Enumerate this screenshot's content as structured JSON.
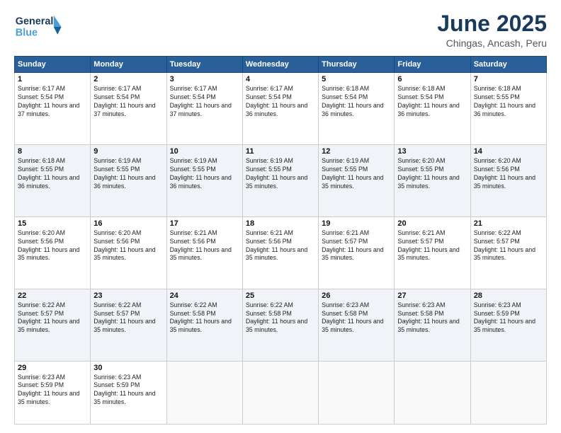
{
  "logo": {
    "line1": "General",
    "line2": "Blue"
  },
  "title": "June 2025",
  "subtitle": "Chingas, Ancash, Peru",
  "days_header": [
    "Sunday",
    "Monday",
    "Tuesday",
    "Wednesday",
    "Thursday",
    "Friday",
    "Saturday"
  ],
  "weeks": [
    [
      {
        "day": "1",
        "sunrise": "6:17 AM",
        "sunset": "5:54 PM",
        "daylight": "11 hours and 37 minutes."
      },
      {
        "day": "2",
        "sunrise": "6:17 AM",
        "sunset": "5:54 PM",
        "daylight": "11 hours and 37 minutes."
      },
      {
        "day": "3",
        "sunrise": "6:17 AM",
        "sunset": "5:54 PM",
        "daylight": "11 hours and 37 minutes."
      },
      {
        "day": "4",
        "sunrise": "6:17 AM",
        "sunset": "5:54 PM",
        "daylight": "11 hours and 36 minutes."
      },
      {
        "day": "5",
        "sunrise": "6:18 AM",
        "sunset": "5:54 PM",
        "daylight": "11 hours and 36 minutes."
      },
      {
        "day": "6",
        "sunrise": "6:18 AM",
        "sunset": "5:54 PM",
        "daylight": "11 hours and 36 minutes."
      },
      {
        "day": "7",
        "sunrise": "6:18 AM",
        "sunset": "5:55 PM",
        "daylight": "11 hours and 36 minutes."
      }
    ],
    [
      {
        "day": "8",
        "sunrise": "6:18 AM",
        "sunset": "5:55 PM",
        "daylight": "11 hours and 36 minutes."
      },
      {
        "day": "9",
        "sunrise": "6:19 AM",
        "sunset": "5:55 PM",
        "daylight": "11 hours and 36 minutes."
      },
      {
        "day": "10",
        "sunrise": "6:19 AM",
        "sunset": "5:55 PM",
        "daylight": "11 hours and 36 minutes."
      },
      {
        "day": "11",
        "sunrise": "6:19 AM",
        "sunset": "5:55 PM",
        "daylight": "11 hours and 35 minutes."
      },
      {
        "day": "12",
        "sunrise": "6:19 AM",
        "sunset": "5:55 PM",
        "daylight": "11 hours and 35 minutes."
      },
      {
        "day": "13",
        "sunrise": "6:20 AM",
        "sunset": "5:55 PM",
        "daylight": "11 hours and 35 minutes."
      },
      {
        "day": "14",
        "sunrise": "6:20 AM",
        "sunset": "5:56 PM",
        "daylight": "11 hours and 35 minutes."
      }
    ],
    [
      {
        "day": "15",
        "sunrise": "6:20 AM",
        "sunset": "5:56 PM",
        "daylight": "11 hours and 35 minutes."
      },
      {
        "day": "16",
        "sunrise": "6:20 AM",
        "sunset": "5:56 PM",
        "daylight": "11 hours and 35 minutes."
      },
      {
        "day": "17",
        "sunrise": "6:21 AM",
        "sunset": "5:56 PM",
        "daylight": "11 hours and 35 minutes."
      },
      {
        "day": "18",
        "sunrise": "6:21 AM",
        "sunset": "5:56 PM",
        "daylight": "11 hours and 35 minutes."
      },
      {
        "day": "19",
        "sunrise": "6:21 AM",
        "sunset": "5:57 PM",
        "daylight": "11 hours and 35 minutes."
      },
      {
        "day": "20",
        "sunrise": "6:21 AM",
        "sunset": "5:57 PM",
        "daylight": "11 hours and 35 minutes."
      },
      {
        "day": "21",
        "sunrise": "6:22 AM",
        "sunset": "5:57 PM",
        "daylight": "11 hours and 35 minutes."
      }
    ],
    [
      {
        "day": "22",
        "sunrise": "6:22 AM",
        "sunset": "5:57 PM",
        "daylight": "11 hours and 35 minutes."
      },
      {
        "day": "23",
        "sunrise": "6:22 AM",
        "sunset": "5:57 PM",
        "daylight": "11 hours and 35 minutes."
      },
      {
        "day": "24",
        "sunrise": "6:22 AM",
        "sunset": "5:58 PM",
        "daylight": "11 hours and 35 minutes."
      },
      {
        "day": "25",
        "sunrise": "6:22 AM",
        "sunset": "5:58 PM",
        "daylight": "11 hours and 35 minutes."
      },
      {
        "day": "26",
        "sunrise": "6:23 AM",
        "sunset": "5:58 PM",
        "daylight": "11 hours and 35 minutes."
      },
      {
        "day": "27",
        "sunrise": "6:23 AM",
        "sunset": "5:58 PM",
        "daylight": "11 hours and 35 minutes."
      },
      {
        "day": "28",
        "sunrise": "6:23 AM",
        "sunset": "5:59 PM",
        "daylight": "11 hours and 35 minutes."
      }
    ],
    [
      {
        "day": "29",
        "sunrise": "6:23 AM",
        "sunset": "5:59 PM",
        "daylight": "11 hours and 35 minutes."
      },
      {
        "day": "30",
        "sunrise": "6:23 AM",
        "sunset": "5:59 PM",
        "daylight": "11 hours and 35 minutes."
      },
      null,
      null,
      null,
      null,
      null
    ]
  ]
}
